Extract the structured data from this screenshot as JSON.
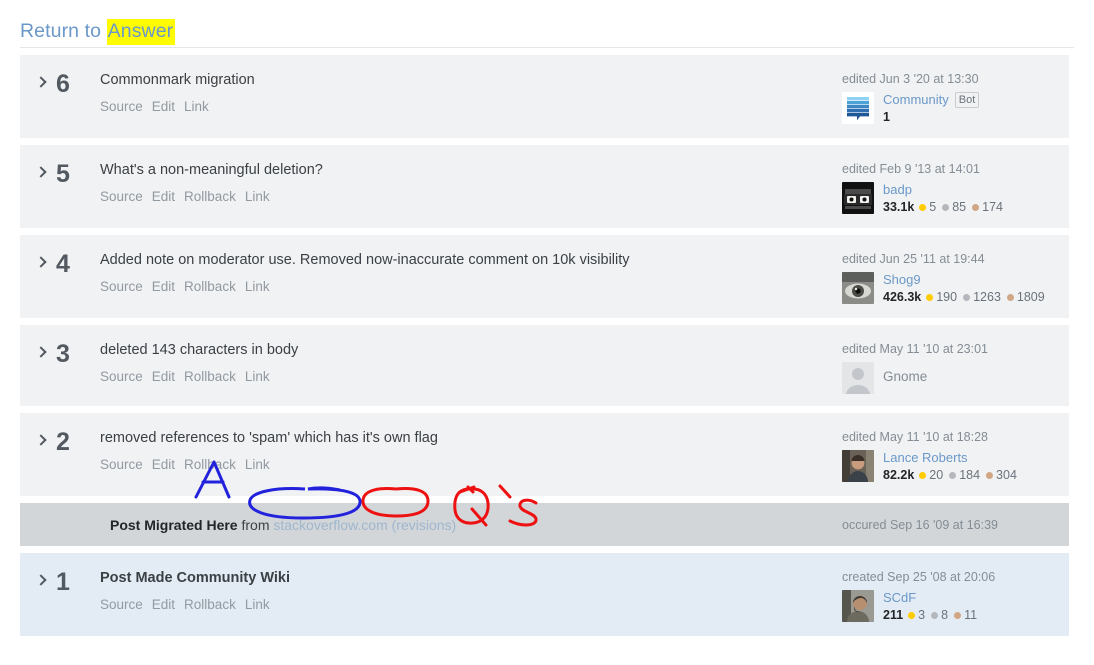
{
  "header": {
    "prefix": "Return to ",
    "highlighted": "Answer",
    "highlight_color": "#fffb00",
    "link_color": "#6a98c8"
  },
  "actions": {
    "source": "Source",
    "edit": "Edit",
    "rollback": "Rollback",
    "link": "Link"
  },
  "revisions": [
    {
      "number": "6",
      "comment": "Commonmark migration",
      "actions": [
        "Source",
        "Edit",
        "Link"
      ],
      "date": "edited Jun 3 '20 at 13:30",
      "user": "Community",
      "user_badge": "Bot",
      "reputation": "1",
      "badges": [],
      "avatar": "community-bot-avatar",
      "row_style": "normal",
      "bold": false
    },
    {
      "number": "5",
      "comment": "What's a non-meaningful deletion?",
      "actions": [
        "Source",
        "Edit",
        "Rollback",
        "Link"
      ],
      "date": "edited Feb 9 '13 at 14:01",
      "user": "badp",
      "reputation": "33.1k",
      "badges": [
        {
          "type": "gold",
          "count": "5"
        },
        {
          "type": "silver",
          "count": "85"
        },
        {
          "type": "bronze",
          "count": "174"
        }
      ],
      "avatar": "badp-avatar",
      "row_style": "normal",
      "bold": false
    },
    {
      "number": "4",
      "comment": "Added note on moderator use. Removed now-inaccurate comment on 10k visibility",
      "actions": [
        "Source",
        "Edit",
        "Rollback",
        "Link"
      ],
      "date": "edited Jun 25 '11 at 19:44",
      "user": "Shog9",
      "reputation": "426.3k",
      "badges": [
        {
          "type": "gold",
          "count": "190"
        },
        {
          "type": "silver",
          "count": "1263"
        },
        {
          "type": "bronze",
          "count": "1809"
        }
      ],
      "avatar": "shog9-avatar",
      "row_style": "normal",
      "bold": false
    },
    {
      "number": "3",
      "comment": "deleted 143 characters in body",
      "actions": [
        "Source",
        "Edit",
        "Rollback",
        "Link"
      ],
      "date": "edited May 11 '10 at 23:01",
      "user": "Gnome",
      "reputation": "",
      "badges": [],
      "avatar": "default-user-avatar",
      "row_style": "normal",
      "bold": false,
      "user_deleted": true
    },
    {
      "number": "2",
      "comment": "removed references to 'spam' which has it's own flag",
      "actions": [
        "Source",
        "Edit",
        "Rollback",
        "Link"
      ],
      "date": "edited May 11 '10 at 18:28",
      "user": "Lance Roberts",
      "reputation": "82.2k",
      "badges": [
        {
          "type": "gold",
          "count": "20"
        },
        {
          "type": "silver",
          "count": "184"
        },
        {
          "type": "bronze",
          "count": "304"
        }
      ],
      "avatar": "lance-roberts-avatar",
      "row_style": "normal",
      "bold": false
    }
  ],
  "migration_row": {
    "label": "Post Migrated Here",
    "from": " from ",
    "site_link": "stackoverflow.com",
    "revisions_link": "(revisions)",
    "date": "occured Sep 16 '09 at 16:39"
  },
  "community_wiki_row": {
    "number": "1",
    "comment": "Post Made Community Wiki",
    "actions": [
      "Source",
      "Edit",
      "Rollback",
      "Link"
    ],
    "date": "created Sep 25 '08 at 20:06",
    "user": "SCdF",
    "reputation": "211",
    "badges": [
      {
        "type": "gold",
        "count": "3"
      },
      {
        "type": "silver",
        "count": "8"
      },
      {
        "type": "bronze",
        "count": "11"
      }
    ],
    "avatar": "scdf-avatar"
  },
  "annotations": [
    {
      "name": "letter-a-markup",
      "text": "A",
      "color": "#2222dd"
    },
    {
      "name": "ellipse-site-link-markup",
      "color": "#2222dd"
    },
    {
      "name": "ellipse-revisions-link-markup",
      "color": "#ee1111"
    },
    {
      "name": "letter-q-markup",
      "text": "Q",
      "color": "#ee1111"
    },
    {
      "name": "letter-s-markup",
      "text": "s",
      "color": "#ee1111"
    }
  ]
}
